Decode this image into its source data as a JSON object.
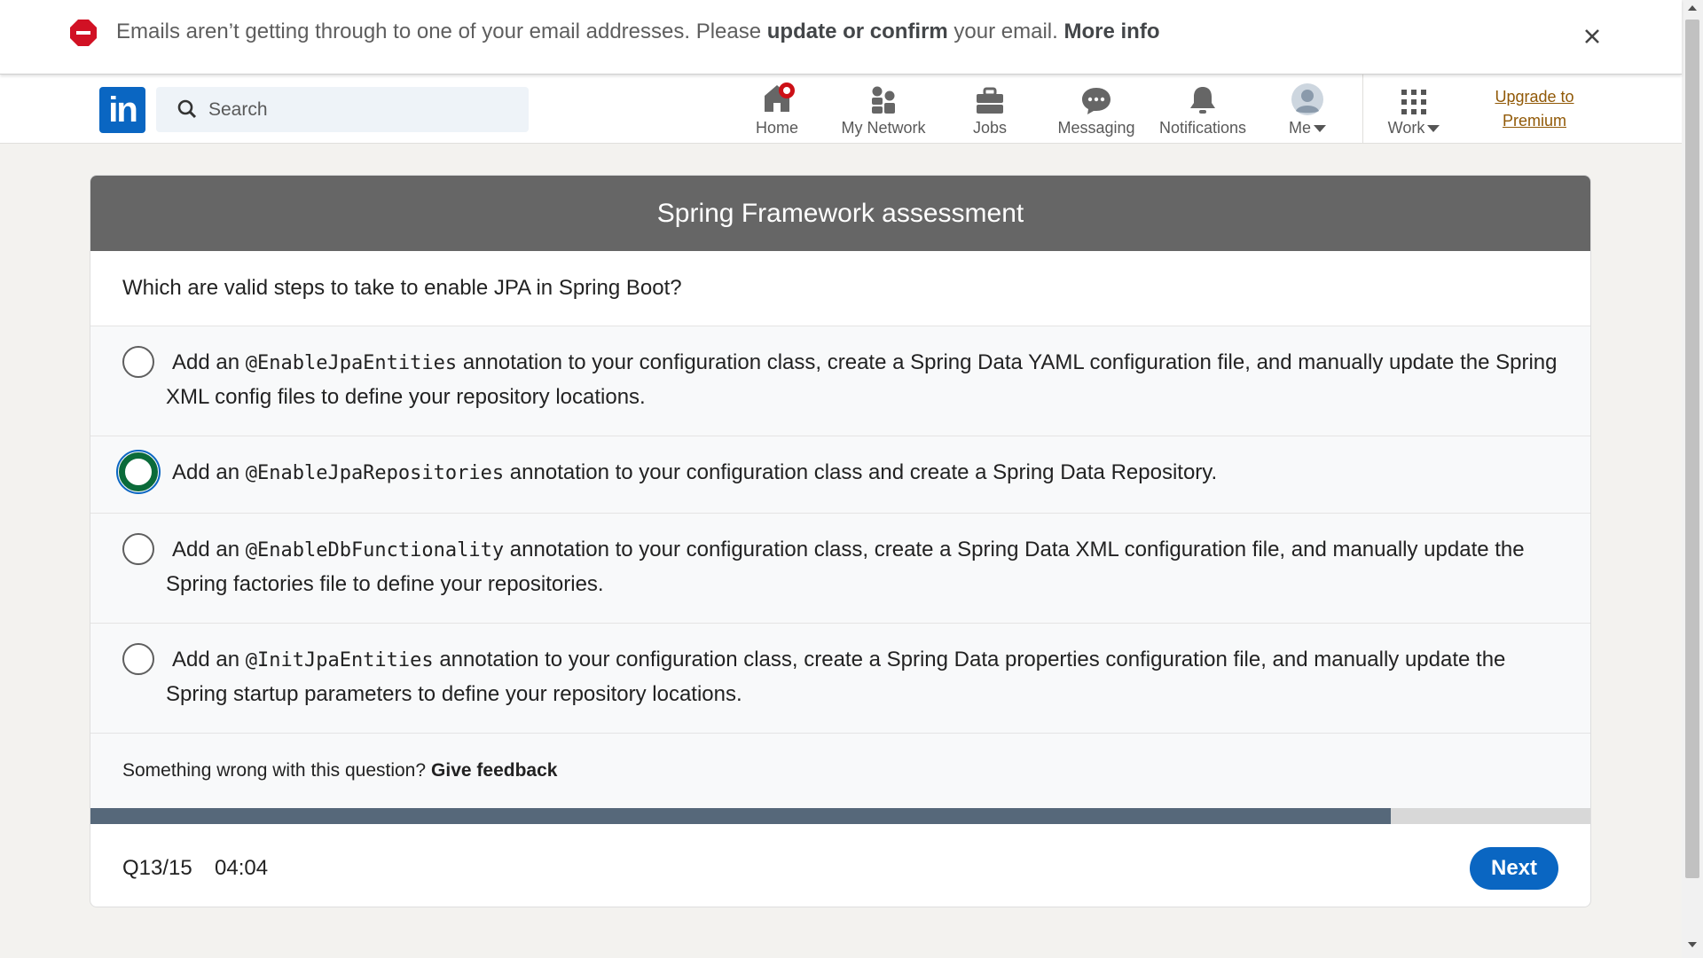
{
  "banner": {
    "message_before": "Emails aren’t getting through to one of your email addresses. Please ",
    "message_link": "update or confirm",
    "message_after": " your email. ",
    "more_info": "More info",
    "icon": "stop-icon",
    "close_icon": "close-icon"
  },
  "nav": {
    "logo_text": "in",
    "search_placeholder": "Search",
    "items": [
      {
        "label": "Home",
        "icon": "home-icon",
        "has_badge": true
      },
      {
        "label": "My Network",
        "icon": "network-icon"
      },
      {
        "label": "Jobs",
        "icon": "briefcase-icon"
      },
      {
        "label": "Messaging",
        "icon": "messaging-icon"
      },
      {
        "label": "Notifications",
        "icon": "bell-icon"
      },
      {
        "label": "Me",
        "icon": "avatar"
      },
      {
        "label": "Work",
        "icon": "grid-icon"
      }
    ],
    "upgrade_line1": "Upgrade to",
    "upgrade_line2": "Premium"
  },
  "assessment": {
    "title": "Spring Framework assessment",
    "question": "Which are valid steps to take to enable JPA in Spring Boot?",
    "options": [
      {
        "prefix": "Add an ",
        "code": "@EnableJpaEntities",
        "suffix": " annotation to your configuration class, create a Spring Data YAML configuration file, and manually update the Spring XML config files to define your repository locations.",
        "selected": false
      },
      {
        "prefix": "Add an ",
        "code": "@EnableJpaRepositories",
        "suffix": " annotation to your configuration class and create a Spring Data Repository.",
        "selected": true
      },
      {
        "prefix": "Add an ",
        "code": "@EnableDbFunctionality",
        "suffix": " annotation to your configuration class, create a Spring Data XML configuration file, and manually update the Spring factories file to define your repositories.",
        "selected": false
      },
      {
        "prefix": "Add an ",
        "code": "@InitJpaEntities",
        "suffix": " annotation to your configuration class, create a Spring Data properties configuration file, and manually update the Spring startup parameters to define your repository locations.",
        "selected": false
      }
    ],
    "feedback_prompt": "Something wrong with this question?",
    "feedback_link": "Give feedback",
    "progress_fraction": 0.867,
    "question_counter": "Q13/15",
    "timer": "04:04",
    "next_label": "Next"
  },
  "colors": {
    "linkedin_blue": "#0a66c2",
    "header_gray": "#666666",
    "selected_green": "#0b6b3a",
    "progress_fill": "#56687a",
    "premium_gold": "#915907",
    "alert_red": "#d11124"
  }
}
